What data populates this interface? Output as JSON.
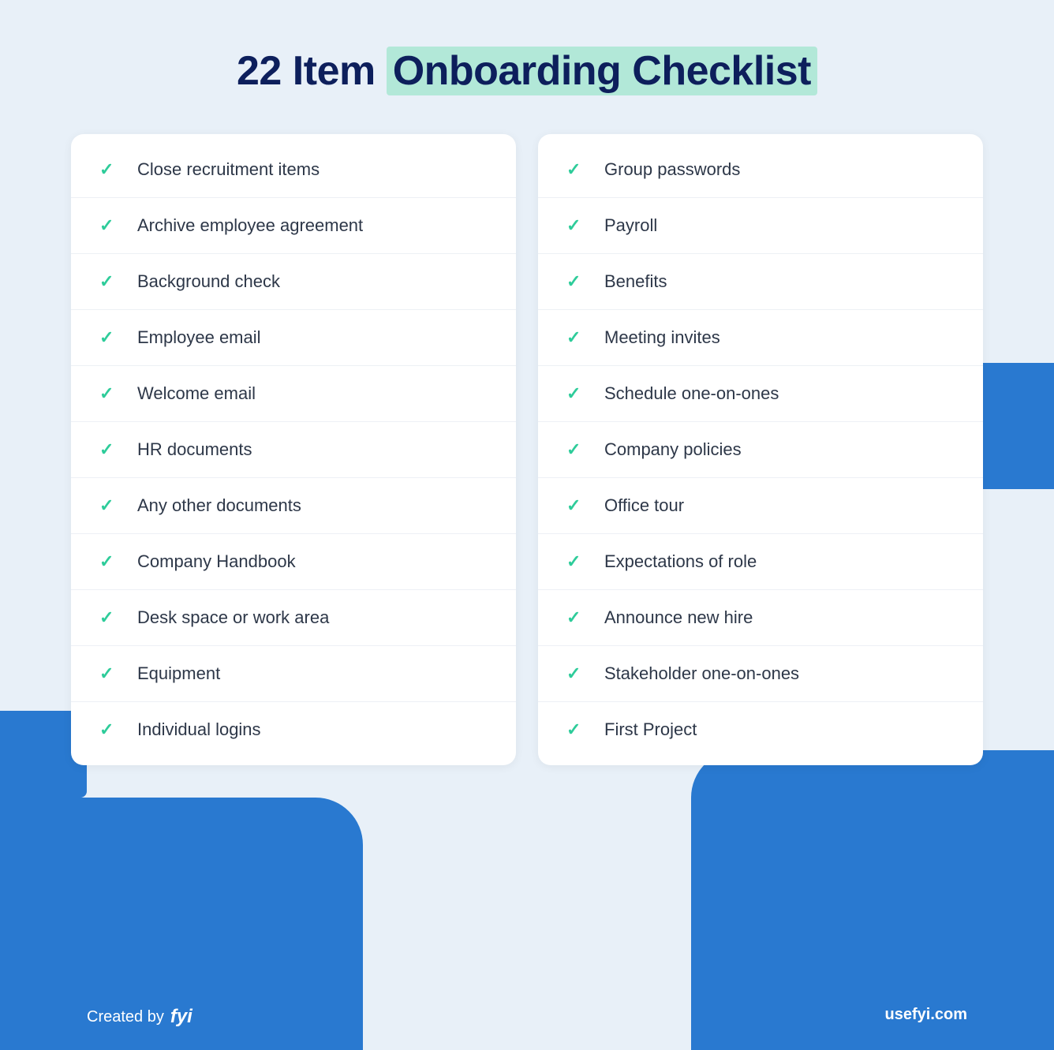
{
  "page": {
    "title_prefix": "22 Item",
    "title_highlight": "Onboarding Checklist",
    "background_color": "#e8f0f8",
    "accent_color": "#2979d0",
    "highlight_bg": "#b2e8d8",
    "title_color": "#0d1f5c"
  },
  "left_column": {
    "items": [
      "Close recruitment items",
      "Archive employee agreement",
      "Background check",
      "Employee email",
      "Welcome email",
      "HR documents",
      "Any other documents",
      "Company Handbook",
      "Desk space or work area",
      "Equipment",
      "Individual logins"
    ]
  },
  "right_column": {
    "items": [
      "Group passwords",
      "Payroll",
      "Benefits",
      "Meeting invites",
      "Schedule one-on-ones",
      "Company policies",
      "Office tour",
      "Expectations of role",
      "Announce new hire",
      "Stakeholder one-on-ones",
      "First Project"
    ]
  },
  "footer": {
    "created_by_label": "Created by",
    "brand_name": "fyi",
    "website": "usefyi.com"
  },
  "icons": {
    "check": "✓"
  }
}
